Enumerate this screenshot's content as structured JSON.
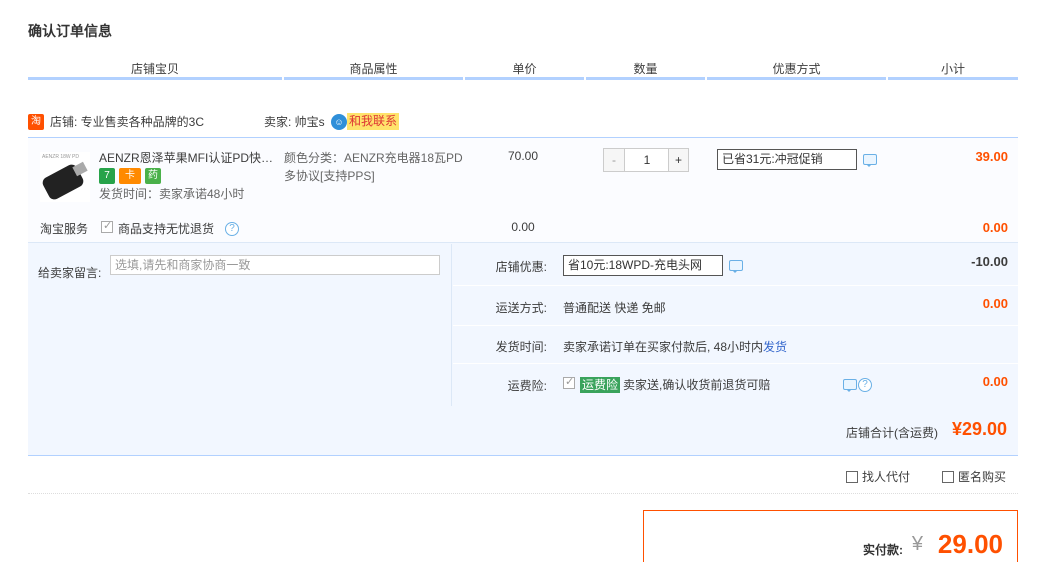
{
  "page_title": "确认订单信息",
  "columns": [
    "店铺宝贝",
    "商品属性",
    "单价",
    "数量",
    "优惠方式",
    "小计"
  ],
  "shop": {
    "icon_text": "淘",
    "name": "店铺: 专业售卖各种品牌的3C",
    "seller": "卖家: 帅宝s",
    "contact_label": "和我联系"
  },
  "item": {
    "title": "AENZR恩泽苹果MFI认证PD快充...",
    "thumb_text": "AENZR 18W PD",
    "badges": [
      "7",
      "卡",
      "药"
    ],
    "ship_time": "发货时间：卖家承诺48小时",
    "attr": "颜色分类：AENZR充电器18瓦PD多协议[支持PPS]",
    "price": "70.00",
    "qty_minus": "-",
    "qty": "1",
    "qty_plus": "+",
    "discount": "已省31元:冲冠促销",
    "subtotal": "39.00"
  },
  "service": {
    "label": "淘宝服务",
    "text": "商品支持无忧退货",
    "price": "0.00",
    "subtotal": "0.00"
  },
  "message": {
    "label": "给卖家留言:",
    "placeholder": "选填,请先和商家协商一致"
  },
  "shop_discount": {
    "label": "店铺优惠:",
    "value": "省10元:18WPD-充电头网",
    "amount": "-10.00"
  },
  "delivery": {
    "label": "运送方式:",
    "value": "普通配送 快递 免邮",
    "amount": "0.00"
  },
  "ship_time_row": {
    "label": "发货时间:",
    "value": "卖家承诺订单在买家付款后, 48小时内",
    "link": "发货"
  },
  "insurance": {
    "label": "运费险:",
    "tag": "运费险",
    "value": "卖家送,确认收货前退货可赔",
    "amount": "0.00"
  },
  "shop_total": {
    "label": "店铺合计(含运费)",
    "value": "¥29.00"
  },
  "options": {
    "proxy_pay": "找人代付",
    "anonymous": "匿名购买"
  },
  "payment": {
    "label": "实付款:",
    "yen": "¥",
    "value": "29.00"
  },
  "colors": {
    "accent": "#ff5000",
    "header_border": "#b2d1ff",
    "panel_bg": "#f2f7ff",
    "link": "#3366cc"
  },
  "icons": [
    "taobao-icon",
    "wangwang-icon",
    "chat-icon",
    "help-icon",
    "checkbox-icon"
  ]
}
